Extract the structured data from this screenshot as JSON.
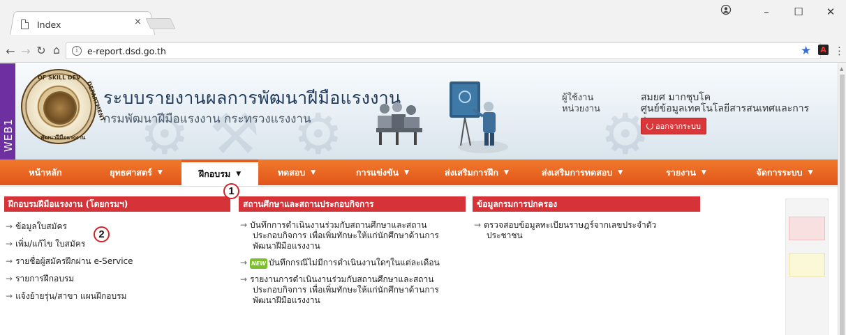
{
  "browser": {
    "tab_title": "Index",
    "tab_close": "×",
    "url": "e-report.dsd.go.th",
    "window_controls": [
      "minimize-icon",
      "maximize-icon",
      "close-icon"
    ],
    "nav_icons": [
      "back-arrow-icon",
      "forward-arrow-icon",
      "reload-icon",
      "home-icon"
    ]
  },
  "header": {
    "side_badge": "WEB1",
    "seal_text_top": "OF SKILL DEV",
    "seal_text_side": "DEPARTMENT",
    "seal_text_bottom": "พัฒนาฝีมือแรงงาน",
    "title": "ระบบรายงานผลการพัฒนาฝีมือแรงงาน",
    "subtitle": "กรมพัฒนาฝีมือแรงงาน กระทรวงแรงงาน",
    "user_label": "ผู้ใช้งาน",
    "unit_label": "หน่วยงาน",
    "user_name": "สมยศ มากชุบโค",
    "unit_name": "ศูนย์ข้อมูลเทคโนโลยีสารสนเทศและการสื่อสาร",
    "logout_label": "ออกจากระบบ"
  },
  "nav": {
    "items": [
      {
        "label": "หน้าหลัก",
        "caret": ""
      },
      {
        "label": "ยุทธศาสตร์",
        "caret": "▼"
      },
      {
        "label": "ฝึกอบรม",
        "caret": "▼"
      },
      {
        "label": "ทดสอบ",
        "caret": "▼"
      },
      {
        "label": "การแข่งขัน",
        "caret": "▼"
      },
      {
        "label": "ส่งเสริมการฝึก",
        "caret": "▼"
      },
      {
        "label": "ส่งเสริมการทดสอบ",
        "caret": "▼"
      },
      {
        "label": "รายงาน",
        "caret": "▼"
      },
      {
        "label": "จัดการระบบ",
        "caret": "▼"
      }
    ],
    "active_index": 2
  },
  "callouts": [
    "1",
    "2"
  ],
  "dropdown": {
    "columns": [
      {
        "heading": "ฝึกอบรมฝีมือแรงงาน (โดยกรมฯ)",
        "links": [
          "ข้อมูลใบสมัคร",
          "เพิ่ม/แก้ไข ใบสมัคร",
          "รายชื่อผู้สมัครฝึกผ่าน e-Service",
          "รายการฝึกอบรม",
          "แจ้งย้ายรุ่น/สาขา แผนฝึกอบรม"
        ]
      },
      {
        "heading": "สถานศึกษาและสถานประกอบกิจการ",
        "links": [
          {
            "line1": "บันทึกการดำเนินงานร่วมกับสถานศึกษาและสถาน",
            "line2": "ประกอบกิจการ เพื่อเพิ่มทักษะให้แก่นักศึกษาด้านการ",
            "line3": "พัฒนาฝีมือแรงงาน"
          },
          {
            "badge": "NEW",
            "line1": "บันทึกกรณีไม่มีการดำเนินงานใดๆในแต่ละเดือน"
          },
          {
            "line1": "รายงานการดำเนินงานร่วมกับสถานศึกษาและสถาน",
            "line2": "ประกอบกิจการ เพื่อเพิ่มทักษะให้แก่นักศึกษาด้านการ",
            "line3": "พัฒนาฝีมือแรงงาน"
          }
        ]
      },
      {
        "heading": "ข้อมูลกรมการปกครอง",
        "links": [
          {
            "line1": "ตรวจสอบข้อมูลทะเบียนราษฎร์จากเลขประจำตัว",
            "line2": "ประชาชน"
          }
        ]
      }
    ],
    "arrow_glyph": "→"
  },
  "colors": {
    "nav_gradient_top": "#f07a2c",
    "nav_gradient_bottom": "#e2541a",
    "column_heading": "#d63338",
    "side_badge": "#6e2fa0",
    "logout_button": "#d9373a",
    "bookmark_star": "#3b6fd8"
  }
}
